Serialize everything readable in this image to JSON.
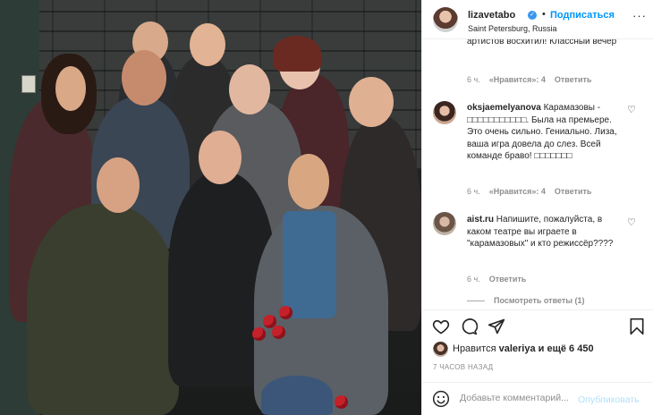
{
  "header": {
    "username": "lizavetabo",
    "follow_label": "Подписаться",
    "location": "Saint Petersburg, Russia",
    "more_label": "···"
  },
  "comments": {
    "partial_text": "артистов восхитил! Классный вечер",
    "partial_meta": {
      "time": "6 ч.",
      "likes": "«Нравится»: 4",
      "reply": "Ответить"
    },
    "items": [
      {
        "username": "oksjaemelyanova",
        "text": "Карамазовы - □□□□□□□□□□□. Была на премьере. Это очень сильно. Гениально. Лиза, ваша игра довела до слез. Всей команде браво! □□□□□□□",
        "time": "6 ч.",
        "likes": "«Нравится»: 4",
        "reply": "Ответить"
      },
      {
        "username": "aist.ru",
        "text": "Напишите, пожалуйста, в каком театре вы играете в \"карамазовых\" и кто режиссёр????",
        "time": "6 ч.",
        "reply": "Ответить"
      }
    ],
    "view_replies": "Посмотреть ответы (1)"
  },
  "likes": {
    "prefix": "Нравится",
    "user": "valeriya",
    "and_more": "и ещё 6 450"
  },
  "time_ago": "7 ЧАСОВ НАЗАД",
  "add_comment": {
    "placeholder": "Добавьте комментарий...",
    "publish_label": "Опубликовать"
  },
  "icons": {
    "like": "heart-icon",
    "comment": "comment-icon",
    "share": "paper-plane-icon",
    "save": "bookmark-icon",
    "emoji": "smiley-icon",
    "comment_like": "heart-icon"
  },
  "colors": {
    "accent": "#0095f6",
    "muted": "#8e8e8e",
    "text": "#262626"
  }
}
